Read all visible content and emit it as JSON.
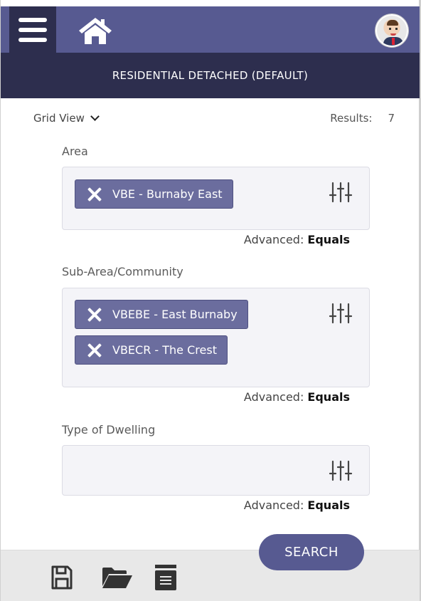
{
  "header": {
    "title": "RESIDENTIAL DETACHED (DEFAULT)",
    "icons": [
      "menu-icon",
      "home-icon",
      "avatar"
    ]
  },
  "toolbar": {
    "grid_view_label": "Grid View",
    "results_label": "Results:",
    "results_count": "7"
  },
  "fields": {
    "area": {
      "label": "Area",
      "chips": [
        "VBE - Burnaby East"
      ],
      "advanced_label": "Advanced:",
      "advanced_value": "Equals"
    },
    "sub_area": {
      "label": "Sub-Area/Community",
      "chips": [
        "VBEBE - East Burnaby",
        "VBECR - The Crest"
      ],
      "advanced_label": "Advanced:",
      "advanced_value": "Equals"
    },
    "dwelling": {
      "label": "Type of Dwelling",
      "chips": [],
      "advanced_label": "Advanced:",
      "advanced_value": "Equals"
    }
  },
  "actions": {
    "search_label": "SEARCH"
  },
  "footer": {
    "icons": [
      "save-icon",
      "open-folder-icon",
      "list-icon"
    ]
  },
  "colors": {
    "header_bg": "#575a91",
    "header_dark": "#2d2e4e",
    "chip_bg": "#6b6d9e",
    "footer_bg": "#e8e8e8"
  }
}
